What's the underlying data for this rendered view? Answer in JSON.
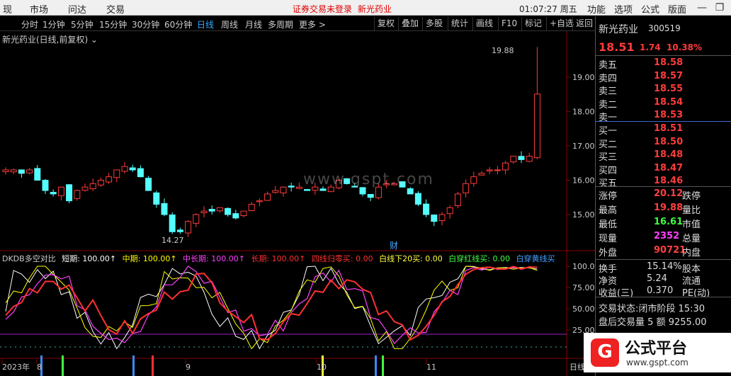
{
  "topbar": {
    "menu": [
      "现",
      "市场",
      "问达",
      "交易"
    ],
    "notice": "证券交易未登录",
    "stock_name": "新光药业",
    "clock": "01:07:27 周五",
    "right_menu": [
      "功能",
      "选项",
      "公式",
      "版面"
    ],
    "win_btns": [
      "—",
      "❐",
      "✕"
    ]
  },
  "toolbar": {
    "periods": [
      "分时",
      "1分钟",
      "5分钟",
      "15分钟",
      "30分钟",
      "60分钟",
      "日线",
      "周线",
      "月线",
      "多周期",
      "更多 >"
    ],
    "active": "日线",
    "right": [
      "复权",
      "叠加",
      "多股",
      "统计",
      "画线",
      "F10",
      "标记",
      "+自选",
      "返回"
    ]
  },
  "chart": {
    "title": "新光药业(日线,前复权)",
    "y_ticks": [
      "19.00",
      "18.00",
      "17.00",
      "16.00",
      "15.00"
    ],
    "price_range": [
      14.0,
      20.0
    ],
    "high_label": "19.88",
    "low_label": "14.27",
    "fin_marker": "财",
    "watermark": "www.gspt.com",
    "x_labels": [
      "2023年",
      "8",
      "9",
      "10",
      "11"
    ],
    "bottom_right": "日线"
  },
  "indicator": {
    "name": "DKDB多空对比",
    "params": [
      {
        "label": "短期: 100.00↑",
        "color": "#ffffff"
      },
      {
        "label": "中期: 100.00↑",
        "color": "#ffff00"
      },
      {
        "label": "中长期: 100.00↑",
        "color": "#ff40ff"
      },
      {
        "label": "长期: 100.00↑",
        "color": "#ff3030"
      },
      {
        "label": "四线归零买: 0.00",
        "color": "#ff3030"
      },
      {
        "label": "白线下20买: 0.00",
        "color": "#ffff40"
      },
      {
        "label": "白穿红线买: 0.00",
        "color": "#40ff40"
      },
      {
        "label": "白穿黄线买",
        "color": "#40a0ff"
      }
    ],
    "y_ticks": [
      "100.0",
      "75.00",
      "50.00",
      "25.00"
    ]
  },
  "quote": {
    "name": "新光药业",
    "code": "300519",
    "price": "18.51",
    "change": "1.74",
    "pct": "10.38%",
    "sell": [
      {
        "label": "卖五",
        "price": "18.58"
      },
      {
        "label": "卖四",
        "price": "18.57"
      },
      {
        "label": "卖三",
        "price": "18.55"
      },
      {
        "label": "卖二",
        "price": "18.54"
      },
      {
        "label": "卖一",
        "price": "18.53"
      }
    ],
    "buy": [
      {
        "label": "买一",
        "price": "18.51"
      },
      {
        "label": "买二",
        "price": "18.50"
      },
      {
        "label": "买三",
        "price": "18.48"
      },
      {
        "label": "买四",
        "price": "18.47"
      },
      {
        "label": "买五",
        "price": "18.46"
      }
    ],
    "stats": [
      {
        "l": "涨停",
        "v": "20.12",
        "r": "跌停",
        "c": "#ff4040"
      },
      {
        "l": "最高",
        "v": "19.88",
        "r": "量比",
        "c": "#ff4040"
      },
      {
        "l": "最低",
        "v": "16.61",
        "r": "市值",
        "c": "#40ff40"
      },
      {
        "l": "现量",
        "v": "2352",
        "r": "总量",
        "c": "#ff40ff"
      },
      {
        "l": "外盘",
        "v": "90721",
        "r": "内盘",
        "c": "#ff4040"
      }
    ],
    "stats2": [
      {
        "l": "换手",
        "v": "15.14%",
        "r": "股本"
      },
      {
        "l": "净资",
        "v": "5.24",
        "r": "流通"
      },
      {
        "l": "收益(三)",
        "v": "0.370",
        "r": "PE(动)"
      }
    ],
    "status_label": "交易状态:",
    "status": "闭市阶段",
    "status_time": "15:30",
    "after": "盘后交易量",
    "after_v": "5",
    "after_amt_l": "额",
    "after_amt": "9255.00"
  },
  "brand": {
    "name": "公式平台",
    "url": "www.gspt.com"
  }
}
